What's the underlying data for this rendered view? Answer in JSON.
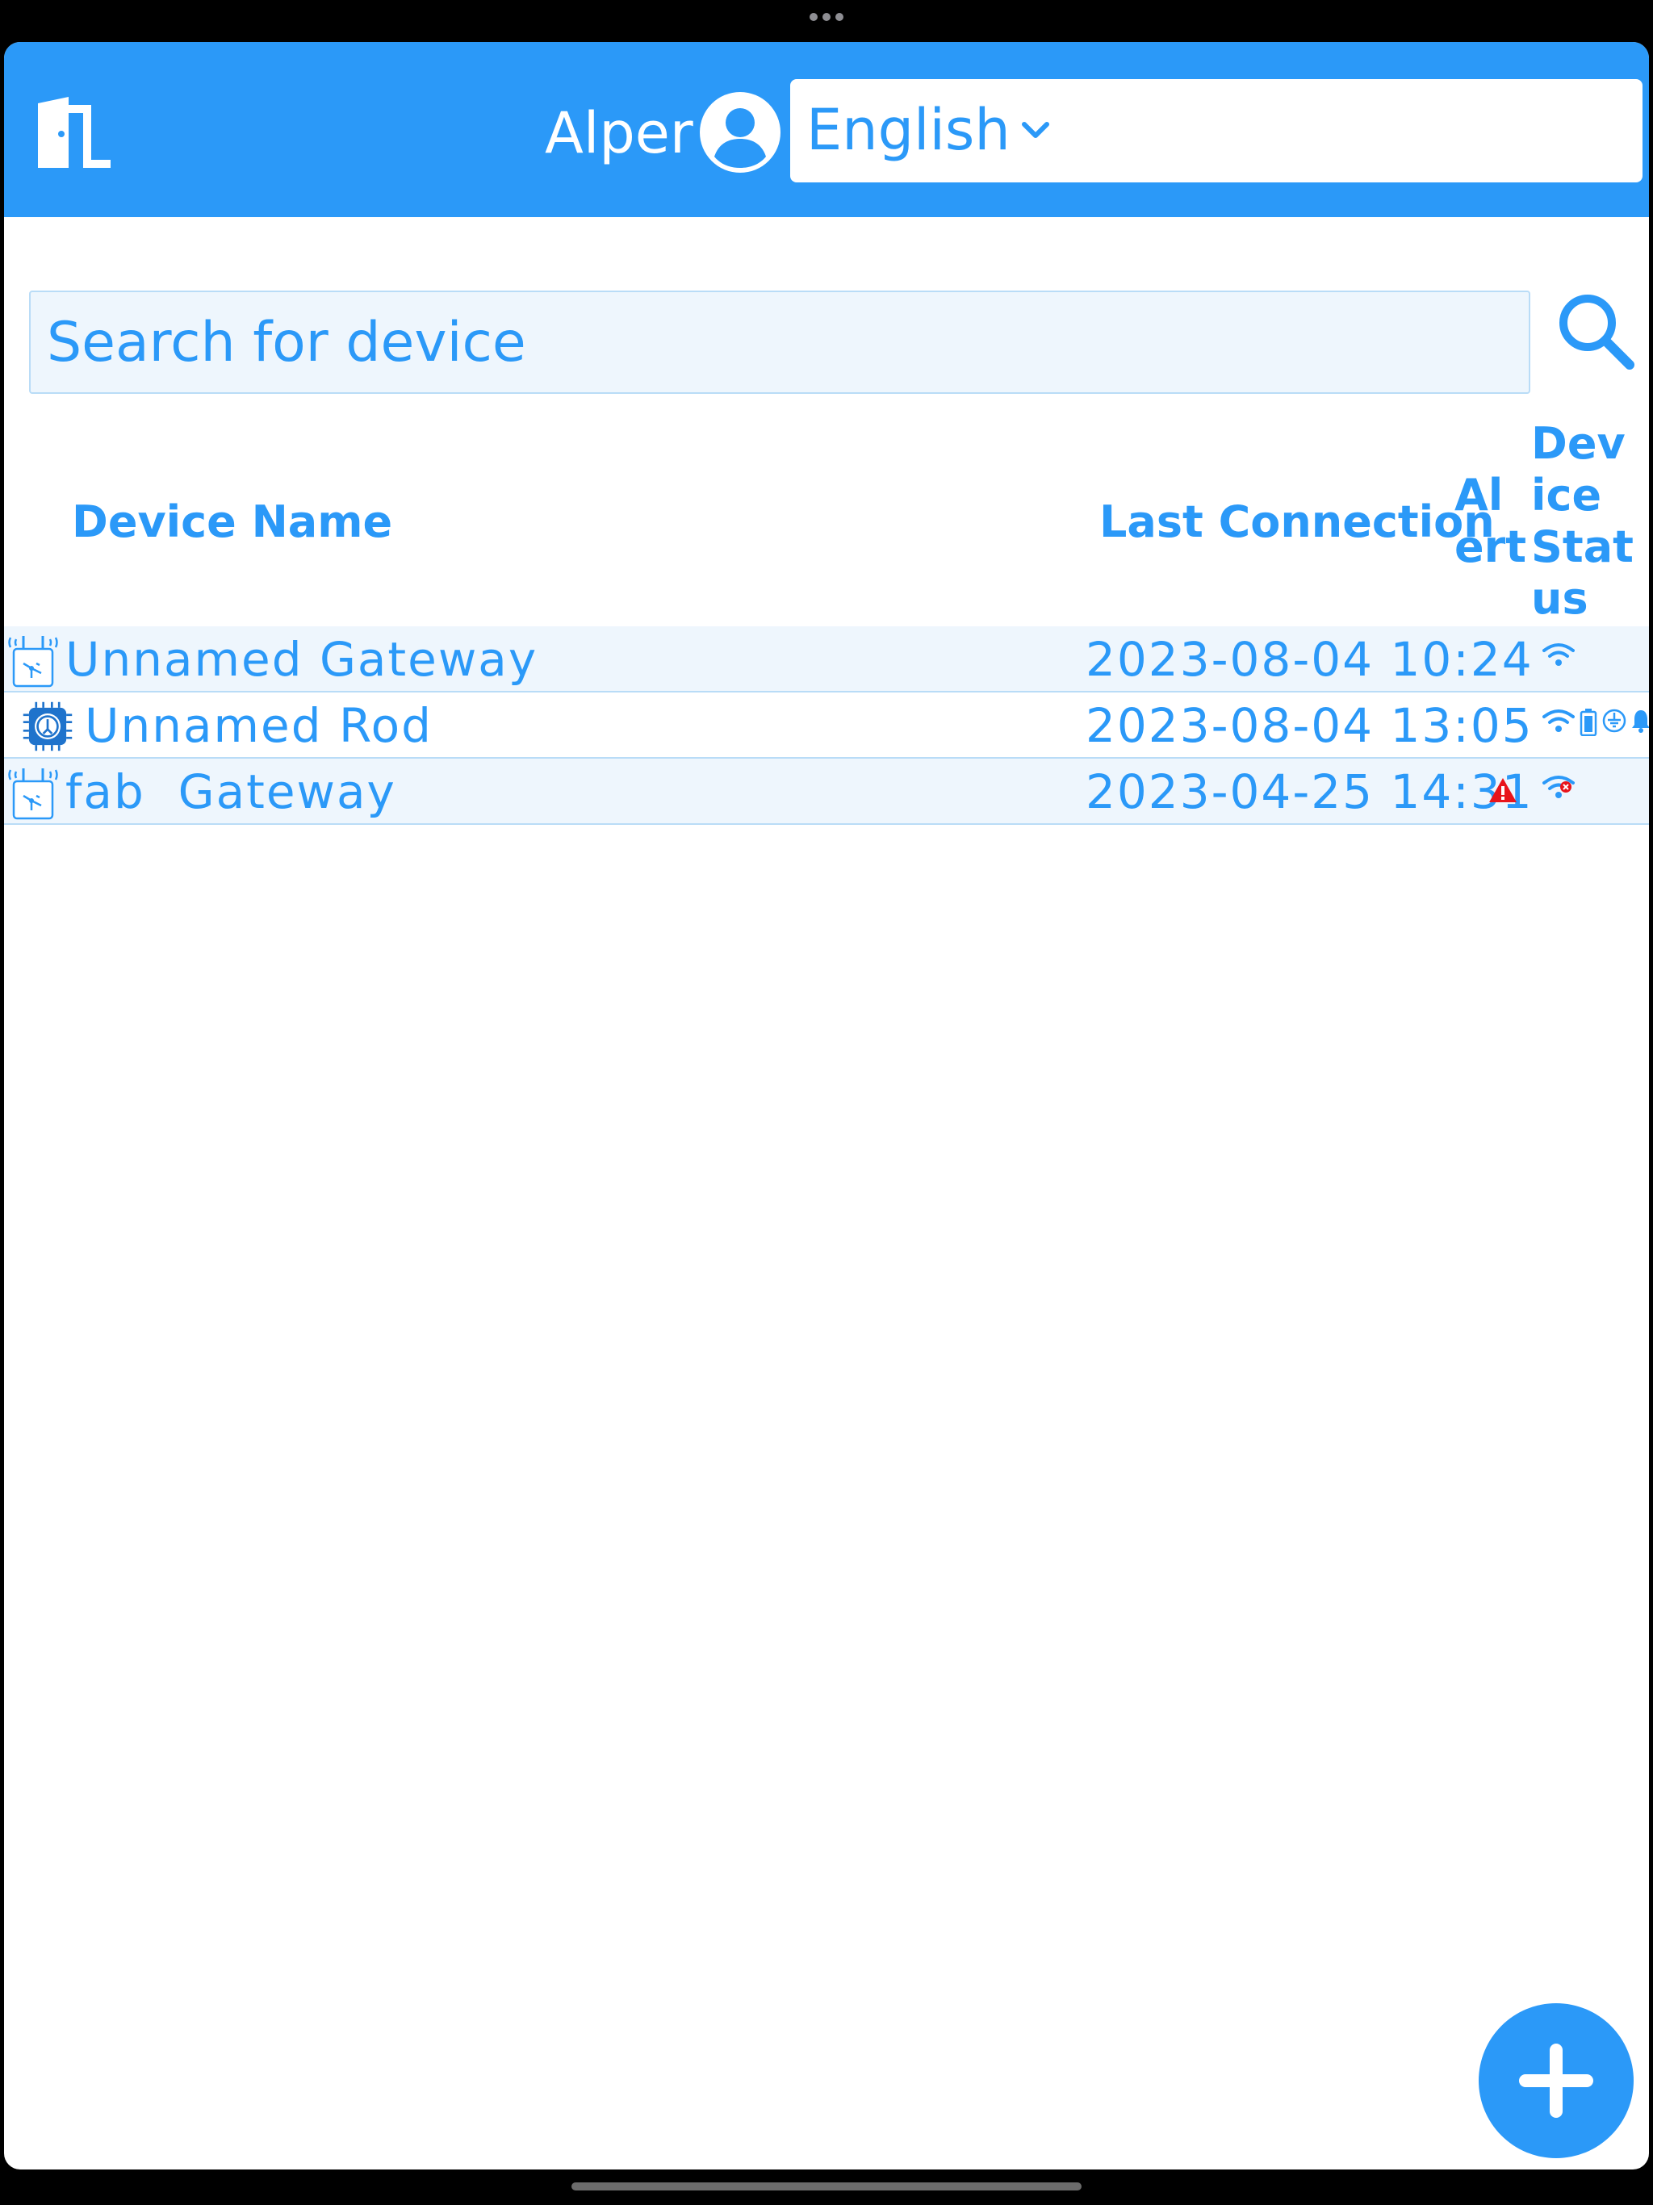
{
  "header": {
    "user_name": "Alper",
    "language": {
      "selected": "English"
    }
  },
  "search": {
    "placeholder": "Search for device"
  },
  "table": {
    "columns": {
      "device_name": "Device Name",
      "last_connection": "Last Connection",
      "alert": "Alert",
      "device_status": "Device Status"
    },
    "rows": [
      {
        "icon": "gateway-icon",
        "name": "Unnamed Gateway",
        "last_connection": "2023-08-04 10:24",
        "alert": null,
        "status_icons": [
          "wifi-icon"
        ]
      },
      {
        "icon": "rod-chip-icon",
        "name": "Unnamed Rod",
        "last_connection": "2023-08-04 13:05",
        "alert": null,
        "status_icons": [
          "wifi-icon",
          "battery-icon",
          "ground-icon",
          "bell-icon"
        ]
      },
      {
        "icon": "gateway-icon",
        "name": "fab  Gateway",
        "last_connection": "2023-04-25 14:31",
        "alert": "warning-icon",
        "status_icons": [
          "wifi-disconnected-icon"
        ]
      }
    ]
  },
  "colors": {
    "primary": "#2b99f8",
    "row_shade": "#eef6fd",
    "row_border": "#b9dcf7",
    "alert": "#e8141b"
  }
}
